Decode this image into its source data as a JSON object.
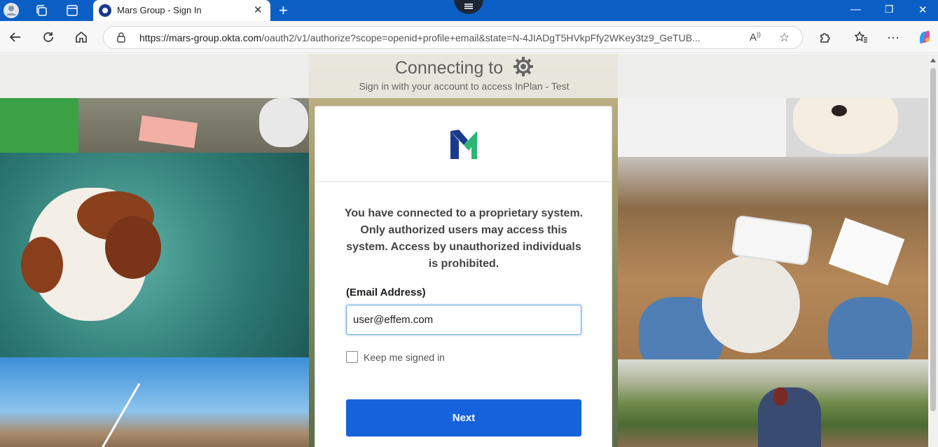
{
  "browser": {
    "tab_title": "Mars Group - Sign In",
    "url_host": "https://mars-group.okta.com",
    "url_path": "/oauth2/v1/authorize?scope=openid+profile+email&state=N-4JIADgT5HVkpFfy2WKey3tz9_GeTUB...",
    "icons": [
      "profile-icon",
      "workspaces-icon",
      "tab-actions-icon",
      "back-icon",
      "refresh-icon",
      "home-icon",
      "lock-icon",
      "read-aloud-icon",
      "favorite-icon",
      "extensions-icon",
      "favorites-icon",
      "more-icon",
      "copilot-icon"
    ]
  },
  "banner": {
    "title": "Connecting to",
    "subtitle": "Sign in with your account to access InPlan - Test"
  },
  "card": {
    "notice": "You have connected to a proprietary system. Only authorized users may access this system. Access by unauthorized individuals is prohibited.",
    "email_label": "(Email Address)",
    "email_value": "user@effem.com",
    "keep_signed_in_label": "Keep me signed in",
    "keep_signed_in_checked": false,
    "next_label": "Next"
  },
  "colors": {
    "titlebar": "#0b5fc4",
    "next_button": "#1662dd",
    "logo_blue": "#1a3a8c",
    "logo_green": "#2bb673"
  }
}
